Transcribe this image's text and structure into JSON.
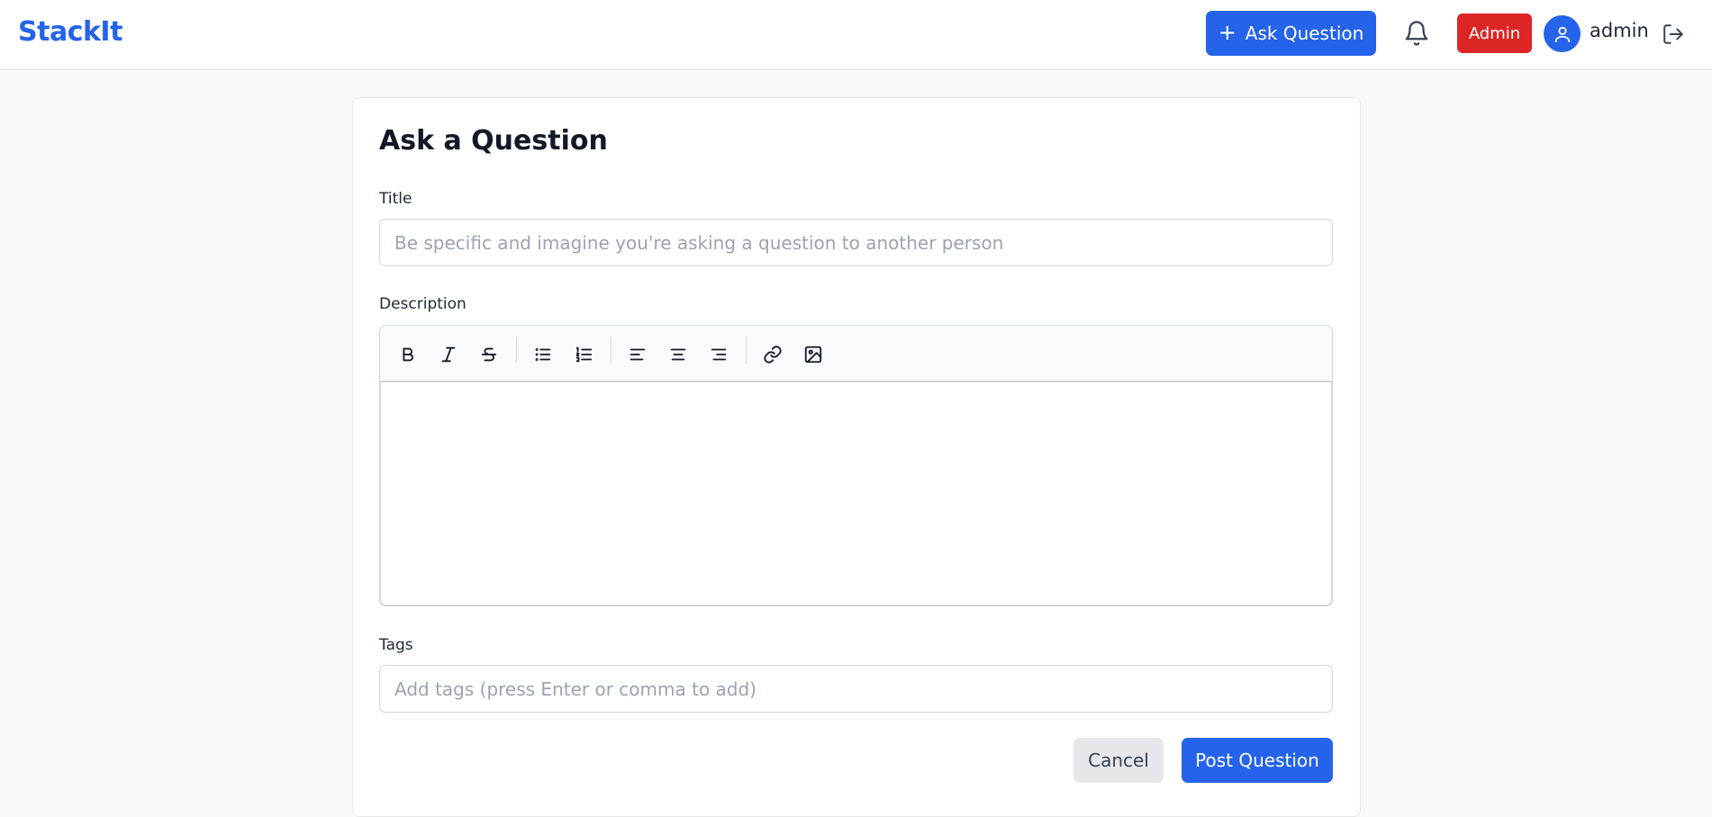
{
  "header": {
    "logo": "StackIt",
    "ask_button_label": "Ask Question",
    "admin_badge": "Admin",
    "username": "admin"
  },
  "form": {
    "title": "Ask a Question",
    "title_label": "Title",
    "title_placeholder": "Be specific and imagine you're asking a question to another person",
    "description_label": "Description",
    "tags_label": "Tags",
    "tags_placeholder": "Add tags (press Enter or comma to add)",
    "cancel_label": "Cancel",
    "submit_label": "Post Question"
  },
  "toolbar": {
    "tools": [
      "bold-icon",
      "italic-icon",
      "strikethrough-icon",
      "bullet-list-icon",
      "numbered-list-icon",
      "align-left-icon",
      "align-center-icon",
      "align-right-icon",
      "link-icon",
      "image-icon"
    ]
  },
  "colors": {
    "brand": "#2563eb",
    "admin_badge": "#dc2626",
    "background": "#f8f9fb"
  }
}
